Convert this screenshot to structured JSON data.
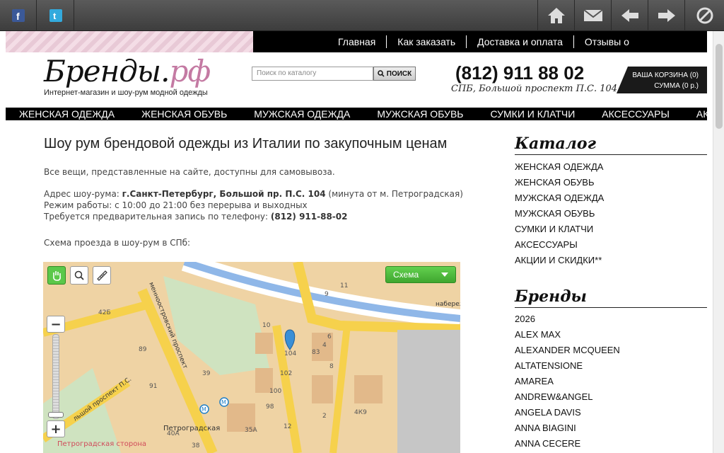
{
  "browser": {
    "social": [
      {
        "name": "facebook-icon",
        "glyph": "f",
        "color": "#3b5998"
      },
      {
        "name": "twitter-icon",
        "glyph": "t",
        "color": "#33aadd"
      }
    ]
  },
  "top_menu": [
    "Главная",
    "Как заказать",
    "Доставка и оплата",
    "Отзывы о"
  ],
  "logo": {
    "main": "Бренды",
    "dot": ".",
    "suffix": "рф",
    "tagline": "Интернет-магазин и шоу-рум модной одежды"
  },
  "search": {
    "placeholder": "Поиск по каталогу",
    "button": "ПОИСК"
  },
  "contact": {
    "phone": "(812) 911 88 02",
    "address": "СПБ, Большой проспект П.С. 104"
  },
  "cart": {
    "line1": "ВАША КОРЗИНА (0)",
    "line2": "СУММА (0 р.)"
  },
  "category_nav": [
    "ЖЕНСКАЯ ОДЕЖДА",
    "ЖЕНСКАЯ ОБУВЬ",
    "МУЖСКАЯ ОДЕЖДА",
    "МУЖСКАЯ ОБУВЬ",
    "СУМКИ И КЛАТЧИ",
    "АКСЕССУАРЫ",
    "АКЦИИ И С"
  ],
  "content": {
    "title": "Шоу рум брендовой одежды из Италии по закупочным ценам",
    "intro": "Все вещи, представленные на сайте, доступны для самовывоза.",
    "address_label": "Адрес шоу-рума: ",
    "address_value": "г.Санкт-Петербург, Большой пр. П.С. 104",
    "address_note": " (минута от м. Петроградская)",
    "hours": "Режим работы: с 10:00 до 21:00 без перерыва и выходных",
    "booking_label": "Требуется предварительная запись по телефону: ",
    "booking_phone": "(812) 911-88-02",
    "route": "Схема проезда в шоу-рум в СПб:"
  },
  "map": {
    "scheme_label": "Схема",
    "labels": {
      "street1": "менноостровский проспект",
      "street2": "набереж",
      "street3": "льшой проспект П.С.",
      "metro": "Петроградская",
      "district": "Петроградская сторона"
    },
    "buildings": [
      "11",
      "9",
      "4",
      "10",
      "104",
      "6",
      "83",
      "102",
      "100",
      "98",
      "2",
      "4К9",
      "35А",
      "40А",
      "38",
      "39",
      "42Б",
      "89",
      "91",
      "8",
      "12"
    ]
  },
  "sidebar": {
    "catalog_title": "Каталог",
    "catalog": [
      "ЖЕНСКАЯ ОДЕЖДА",
      "ЖЕНСКАЯ ОБУВЬ",
      "МУЖСКАЯ ОДЕЖДА",
      "МУЖСКАЯ ОБУВЬ",
      "СУМКИ И КЛАТЧИ",
      "АКСЕССУАРЫ",
      "АКЦИИ И СКИДКИ**"
    ],
    "brands_title": "Бренды",
    "brands": [
      "2026",
      "ALEX MAX",
      "ALEXANDER MCQUEEN",
      "ALTATENSIONE",
      "AMAREA",
      "ANDREW&ANGEL",
      "ANGELA DAVIS",
      "ANNA BIAGINI",
      "ANNA CECERE"
    ]
  }
}
